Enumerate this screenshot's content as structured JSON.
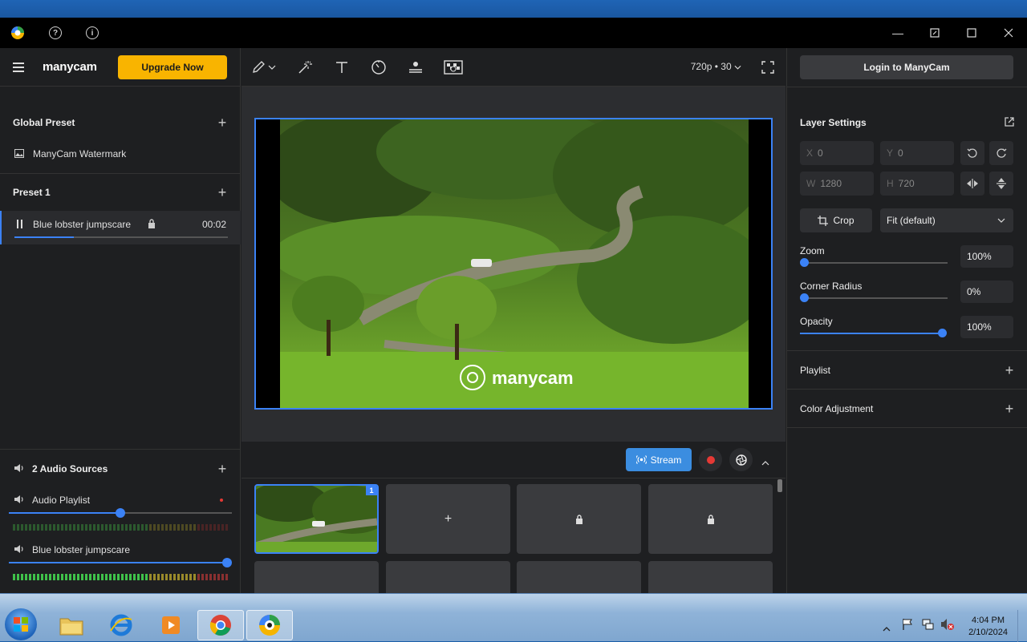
{
  "app": {
    "brand": "manycam",
    "upgrade_label": "Upgrade Now",
    "login_label": "Login to ManyCam"
  },
  "titlebar": {
    "help_glyph": "?",
    "info_glyph": "i"
  },
  "left": {
    "global_preset": "Global Preset",
    "global_items": [
      {
        "label": "ManyCam Watermark",
        "icon": "image-icon"
      }
    ],
    "preset_title": "Preset 1",
    "preset_items": [
      {
        "label": "Blue lobster jumpscare",
        "time": "00:02",
        "progress": 0.28
      }
    ],
    "audio_title": "2 Audio Sources",
    "audio_sources": [
      {
        "label": "Audio Playlist",
        "volume": 0.5
      },
      {
        "label": "Blue lobster jumpscare",
        "volume": 1.0
      }
    ]
  },
  "toolbar": {
    "resolution": "720p • 30"
  },
  "preview": {
    "watermark": "manycam"
  },
  "stream": {
    "label": "Stream"
  },
  "grid": {
    "badge": "1"
  },
  "right": {
    "layer_settings": "Layer Settings",
    "x_label": "X",
    "x_value": "0",
    "y_label": "Y",
    "y_value": "0",
    "w_label": "W",
    "w_value": "1280",
    "h_label": "H",
    "h_value": "720",
    "crop_label": "Crop",
    "fit_value": "Fit (default)",
    "zoom_label": "Zoom",
    "zoom_value": "100%",
    "zoom_level": 0,
    "corner_label": "Corner Radius",
    "corner_value": "0%",
    "corner_level": 0,
    "opacity_label": "Opacity",
    "opacity_value": "100%",
    "opacity_level": 1.0,
    "playlist_label": "Playlist",
    "color_label": "Color Adjustment"
  },
  "taskbar": {
    "time": "4:04 PM",
    "date": "2/10/2024"
  },
  "colors": {
    "accent": "#3b82f6",
    "upgrade": "#f9b400",
    "record": "#e53935"
  }
}
